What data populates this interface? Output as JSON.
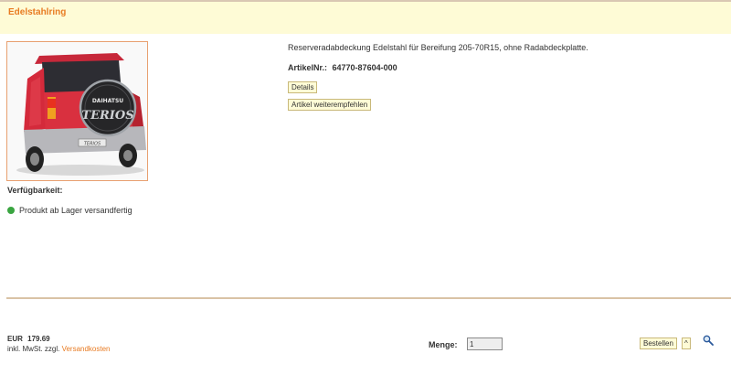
{
  "header": {
    "title": "Edelstahlring"
  },
  "product": {
    "description": "Reserveradabdeckung Edelstahl für Bereifung 205-70R15, ohne Radabdeckplatte.",
    "article_label": "ArtikelNr.:",
    "article_number": "64770-87604-000",
    "image_icon": "car-image",
    "badge_text": "TERIOS",
    "spare_cover_brand": "DAIHATSU",
    "spare_cover_logo": "TERIOS"
  },
  "buttons": {
    "details": "Details",
    "recommend": "Artikel weiterempfehlen",
    "order": "Bestellen",
    "up": "^"
  },
  "availability": {
    "label": "Verfügbarkeit:",
    "status_text": "Produkt ab Lager versandfertig",
    "status_color": "#3aa541"
  },
  "price": {
    "currency": "EUR",
    "value": "179.69",
    "tax_text": "inkl. MwSt. zzgl.",
    "shipping_link": "Versandkosten"
  },
  "quantity": {
    "label": "Menge:",
    "value": "1"
  },
  "colors": {
    "accent": "#e87b22",
    "header_bg": "#fefbd6",
    "button_border": "#c9b97a"
  },
  "icons": {
    "search": "magnifier-icon"
  }
}
